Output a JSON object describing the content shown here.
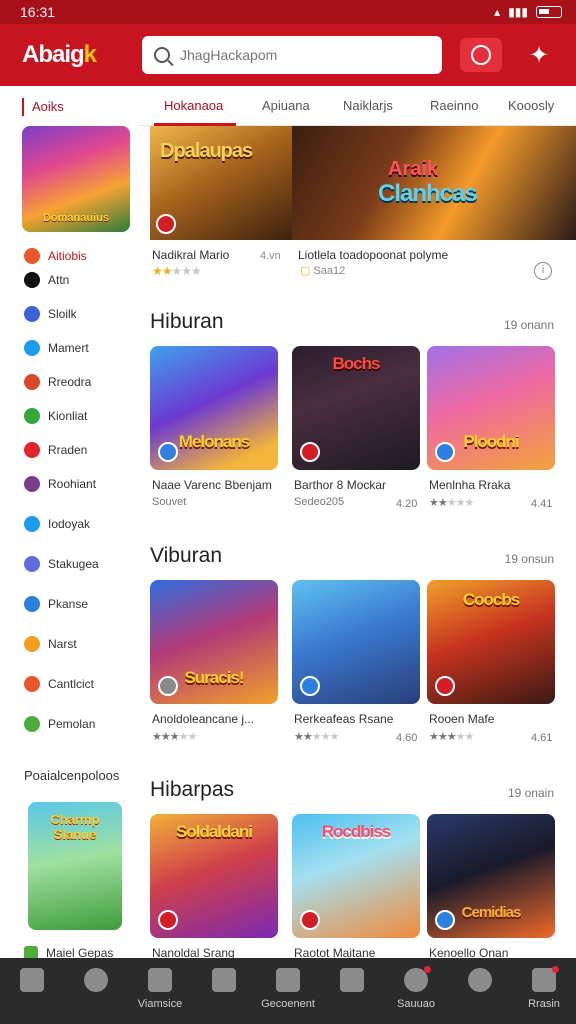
{
  "status_bar": {
    "time": "16:31"
  },
  "header": {
    "logo": "Abaig",
    "logo_accent": "k",
    "search_placeholder": "JhagHackapom"
  },
  "sidebar": {
    "title": "Aoiks",
    "feature_title": "Domanauius",
    "items": [
      {
        "label": "Aitiobis",
        "icon": "grid-icon",
        "color": "#e8572b",
        "active": true
      },
      {
        "label": "Attn",
        "icon": "tag-icon",
        "color": "#111111",
        "active": false
      },
      {
        "label": "Sloilk",
        "icon": "globe-icon",
        "color": "#3a63d8",
        "active": false
      },
      {
        "label": "Mamert",
        "icon": "twitter-icon",
        "color": "#1d9bf0",
        "active": false
      },
      {
        "label": "Rreodra",
        "icon": "flower-icon",
        "color": "#d9482b",
        "active": false
      },
      {
        "label": "Kionliat",
        "icon": "leaf-icon",
        "color": "#34a537",
        "active": false
      },
      {
        "label": "Rraden",
        "icon": "chart-icon",
        "color": "#e3242b",
        "active": false
      },
      {
        "label": "Roohiant",
        "icon": "avatar-icon",
        "color": "#7a3d8c",
        "active": false
      },
      {
        "label": "Iodoyak",
        "icon": "bird-icon",
        "color": "#1d9bf0",
        "active": false
      },
      {
        "label": "Stakugea",
        "icon": "circle-icon",
        "color": "#5f6bd8",
        "active": false
      },
      {
        "label": "Pkanse",
        "icon": "square-icon",
        "color": "#2a7fd8",
        "active": false
      },
      {
        "label": "Narst",
        "icon": "moon-icon",
        "color": "#f2a01e",
        "active": false
      },
      {
        "label": "Cantlcict",
        "icon": "star-icon",
        "color": "#e8572b",
        "active": false
      },
      {
        "label": "Pemolan",
        "icon": "game-icon",
        "color": "#4fae3b",
        "active": false
      }
    ],
    "sub_title": "Poaialcenpoloos",
    "card_title": "Charmp Slanue",
    "bottom_item": "Maiel Gepas"
  },
  "tabs": [
    "Hokanaoa",
    "Apiuana",
    "Naiklarjs",
    "Raeinno",
    "Kooosly"
  ],
  "banner": {
    "left_title": "Dpalaupas",
    "right_title_top": "Araik",
    "right_title_bottom": "Clanhcas",
    "caption_left": "Nadikral Mario",
    "caption_left_value": "4.vn",
    "caption_right": "Liotlela toadopoonat polyme",
    "caption_right_sub": "Saa12",
    "left_rating": 2
  },
  "sections": [
    {
      "title": "Hiburan",
      "more": "19 onann",
      "cards": [
        {
          "art": "Melonans",
          "name": "Naae Varenc Bbenjam",
          "sub": "Souvet",
          "val": "",
          "rating": 0
        },
        {
          "art": "Bochs",
          "name": "Barthor 8 Mockar",
          "sub": "Sedeo205",
          "val": "4.20",
          "rating": 0
        },
        {
          "art": "Ploodni",
          "name": "Menlnha Rraka",
          "sub": "",
          "val": "4.41",
          "rating": 2
        }
      ]
    },
    {
      "title": "Viburan",
      "more": "19 onsun",
      "cards": [
        {
          "art": "Suracis!",
          "name": "Anoldoleancane j...",
          "sub": "",
          "val": "",
          "rating": 3
        },
        {
          "art": "",
          "name": "Rerkeafeas Rsane",
          "sub": "",
          "val": "4.60",
          "rating": 2
        },
        {
          "art": "Coocbs",
          "name": "Rooen Mafe",
          "sub": "",
          "val": "4.61",
          "rating": 3
        }
      ]
    },
    {
      "title": "Hibarpas",
      "more": "19 onain",
      "cards": [
        {
          "art": "Soldaldani",
          "name": "Nanoldal Srang",
          "sub": "",
          "val": "",
          "rating": 0
        },
        {
          "art": "Rocdbiss",
          "name": "Raotot Maitane",
          "sub": "",
          "val": "",
          "rating": 0
        },
        {
          "art": "Cemidias",
          "name": "Kenoello Onan",
          "sub": "",
          "val": "",
          "rating": 0
        }
      ]
    }
  ],
  "bottom_nav": [
    {
      "label": "",
      "icon": "home-icon"
    },
    {
      "label": "",
      "icon": "search-icon"
    },
    {
      "label": "Viamsice",
      "icon": "box-icon"
    },
    {
      "label": "",
      "icon": "store-icon"
    },
    {
      "label": "Gecoenent",
      "icon": "camera-icon"
    },
    {
      "label": "",
      "icon": "chat-icon"
    },
    {
      "label": "Sauuao",
      "icon": "compass-icon"
    },
    {
      "label": "",
      "icon": "search-alt-icon"
    },
    {
      "label": "Rrasin",
      "icon": "profile-icon"
    }
  ],
  "colors": {
    "brand": "#c8141f",
    "star": "#f2b01e",
    "nav_bg": "#2b2b2b"
  }
}
